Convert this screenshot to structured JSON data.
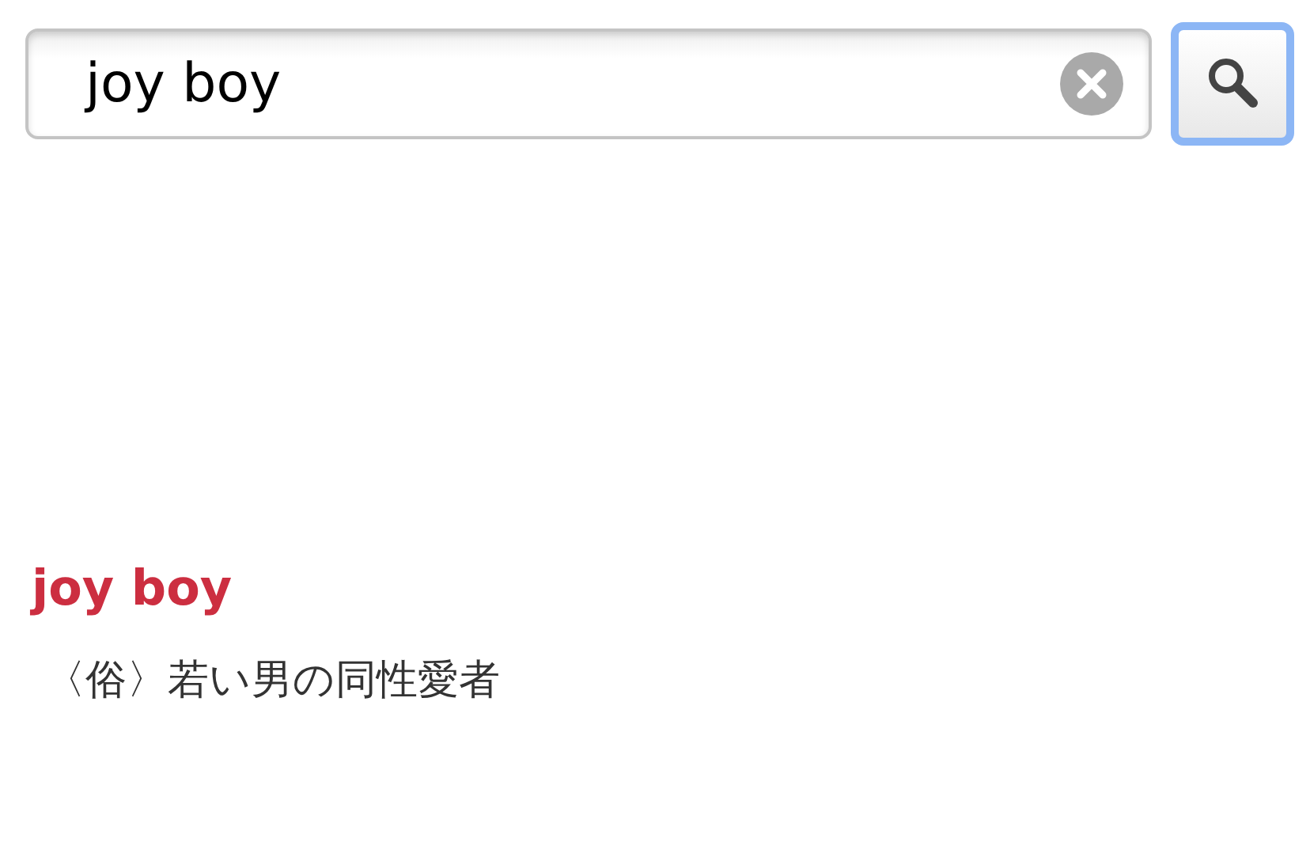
{
  "search": {
    "value": "joy boy",
    "focused_button": true
  },
  "entry": {
    "headword": "joy boy",
    "definition": "〈俗〉若い男の同性愛者"
  }
}
